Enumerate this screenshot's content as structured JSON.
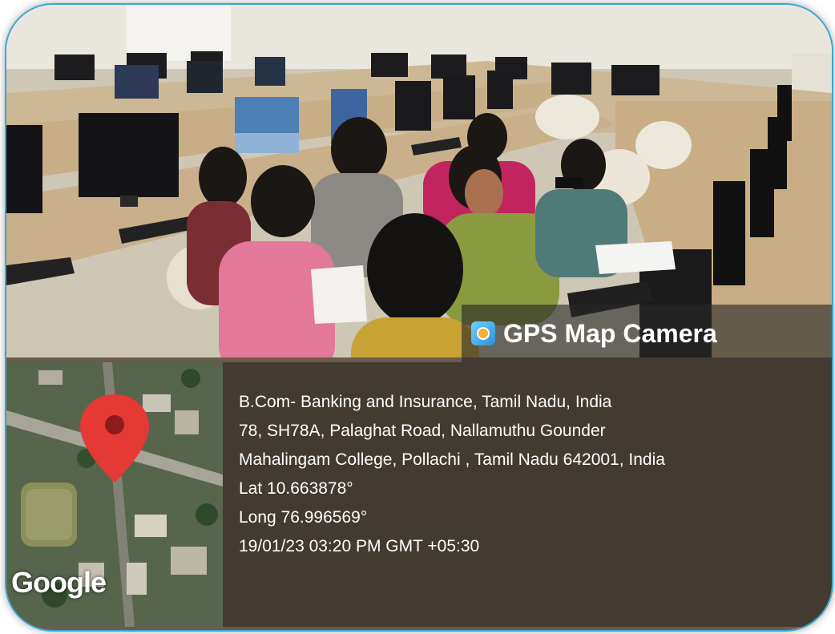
{
  "watermark": {
    "app_name": "GPS Map Camera",
    "app_icon": "gps-map-camera-icon"
  },
  "location": {
    "title": "B.Com- Banking and Insurance, Tamil Nadu, India",
    "address_line1": "78, SH78A, Palaghat Road, Nallamuthu Gounder",
    "address_line2": "Mahalingam College, Pollachi , Tamil Nadu 642001, India",
    "lat": "Lat 10.663878°",
    "long": "Long 76.996569°",
    "timestamp": "19/01/23 03:20 PM GMT +05:30"
  },
  "map": {
    "provider_logo": "Google",
    "pin_icon": "map-pin-icon"
  },
  "colors": {
    "frame_border": "#3aa6d6",
    "pin": "#e53935"
  }
}
